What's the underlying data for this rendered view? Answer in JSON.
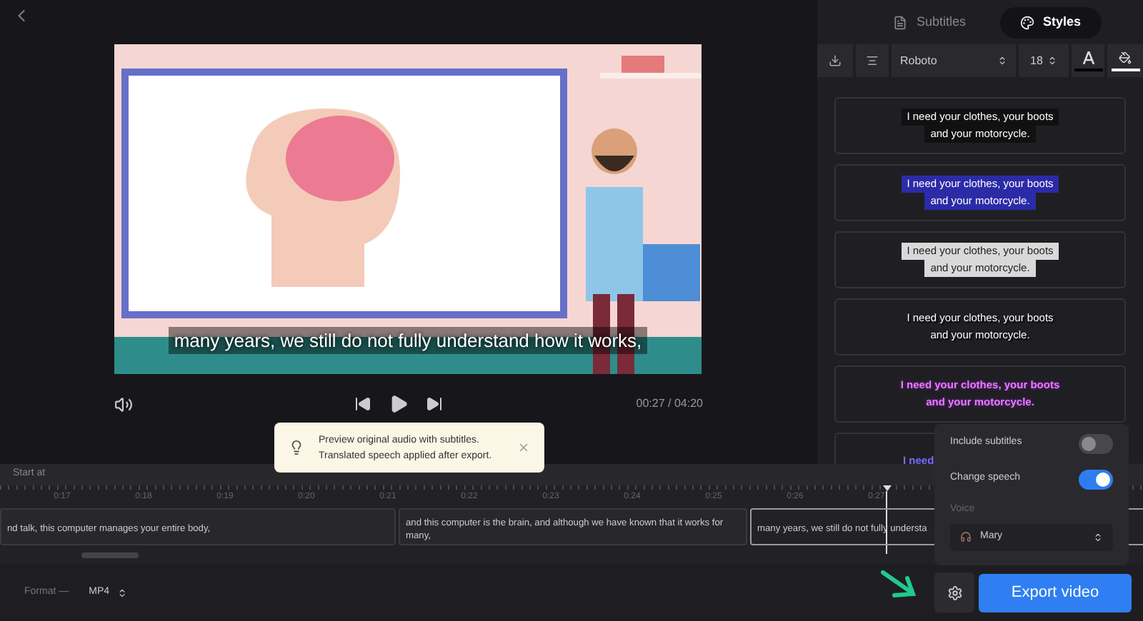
{
  "player": {
    "caption": "many years, we still do not fully understand how it works,",
    "time": "00:27 / 04:20"
  },
  "tooltip": {
    "lines": [
      "Preview original audio with subtitles.",
      "Translated speech applied after export."
    ]
  },
  "tabs": [
    {
      "label": "Subtitles",
      "selected": false
    },
    {
      "label": "Styles",
      "selected": true
    }
  ],
  "toolbar": {
    "font": "Roboto",
    "size": "18"
  },
  "style_cards": [
    {
      "kind": "black-box",
      "lines": [
        "I need your clothes, your boots",
        "and your motorcycle."
      ]
    },
    {
      "kind": "blue-box",
      "lines": [
        "I need your clothes, your boots",
        "and your motorcycle."
      ]
    },
    {
      "kind": "light-box",
      "lines": [
        "I need your clothes, your boots",
        "and your motorcycle."
      ]
    },
    {
      "kind": "shadow",
      "lines": [
        "I need your clothes, your boots",
        "and your motorcycle."
      ]
    },
    {
      "kind": "purple-glow",
      "lines": [
        "I need your clothes, your boots",
        "and your motorcycle."
      ]
    },
    {
      "kind": "blue-glow",
      "lines": [
        "I need"
      ]
    }
  ],
  "timeline": {
    "label": "Start at",
    "ticks": [
      "0:17",
      "0:18",
      "0:19",
      "0:20",
      "0:21",
      "0:22",
      "0:23",
      "0:24",
      "0:25",
      "0:26",
      "0:27"
    ],
    "clips": [
      {
        "text": "nd talk, this computer manages your entire body,",
        "selected": false
      },
      {
        "text": "and this computer is the brain, and although we have known that it works for many,",
        "selected": false
      },
      {
        "text": "many years, we still do not fully understa",
        "selected": true
      }
    ]
  },
  "export": {
    "format_label": "Format —",
    "format": "MP4",
    "button": "Export video"
  },
  "popup": {
    "include_subtitles": {
      "label": "Include subtitles",
      "on": false
    },
    "change_speech": {
      "label": "Change speech",
      "on": true
    },
    "voice_label": "Voice",
    "voice": "Mary"
  }
}
